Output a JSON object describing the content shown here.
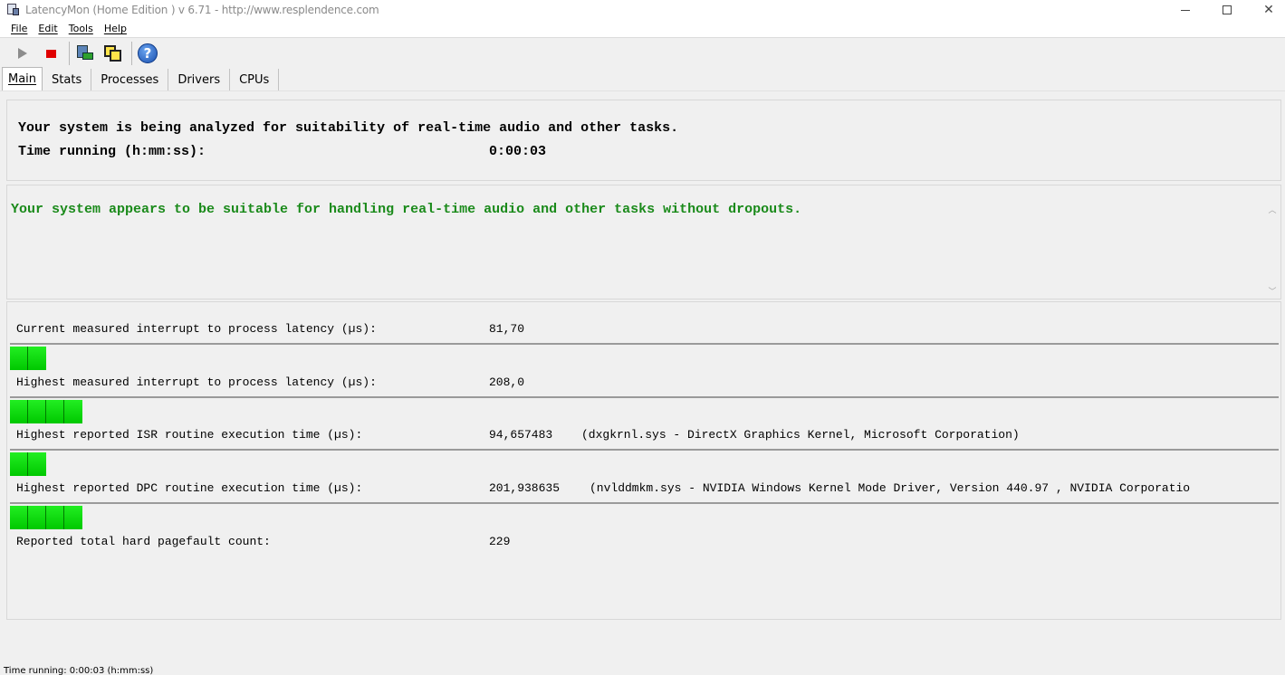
{
  "window": {
    "title": "LatencyMon  (Home Edition )  v 6.71 - http://www.resplendence.com",
    "icon": "latencymon-app-icon",
    "minimize_icon": "minimize-icon",
    "maximize_icon": "maximize-icon",
    "close_glyph": "✕"
  },
  "menu": {
    "items": [
      "File",
      "Edit",
      "Tools",
      "Help"
    ]
  },
  "toolbar": {
    "buttons": [
      "play-icon",
      "stop-icon",
      "drivers-icon",
      "windows-icon",
      "help-icon"
    ],
    "help_glyph": "?",
    "colors": {
      "stop": "#e00000",
      "play": "#8c8c8c"
    }
  },
  "tabs": {
    "items": [
      "Main",
      "Stats",
      "Processes",
      "Drivers",
      "CPUs"
    ],
    "active": "Main"
  },
  "main": {
    "analyze_text": "Your system is being analyzed for suitability of real-time audio and other tasks.",
    "time_label": "Time running (h:mm:ss):",
    "time_value": "0:00:03",
    "result_message": "Your system appears to be suitable for handling real-time audio and other tasks without dropouts.",
    "result_color": "#1a8a1a",
    "scroll_up": "︿",
    "scroll_down": "﹀"
  },
  "metrics": [
    {
      "label": "Current measured interrupt to process latency (µs):",
      "value": "81,70",
      "detail": "",
      "bar_segments": 2
    },
    {
      "label": "Highest measured interrupt to process latency (µs):",
      "value": "208,0",
      "detail": "",
      "bar_segments": 4
    },
    {
      "label": "Highest reported ISR routine execution time (µs):",
      "value": "94,657483",
      "detail": "(dxgkrnl.sys - DirectX Graphics Kernel, Microsoft Corporation)",
      "bar_segments": 2
    },
    {
      "label": "Highest reported DPC routine execution time (µs):",
      "value": "201,938635",
      "detail": "(nvlddmkm.sys - NVIDIA Windows Kernel Mode Driver, Version 440.97 , NVIDIA Corporatio",
      "bar_segments": 4
    },
    {
      "label": "Reported total hard pagefault count:",
      "value": "229",
      "detail": "",
      "bar_segments": 0
    }
  ],
  "bar_color": "#00d800",
  "status": {
    "text": "Time running: 0:00:03  (h:mm:ss)"
  }
}
